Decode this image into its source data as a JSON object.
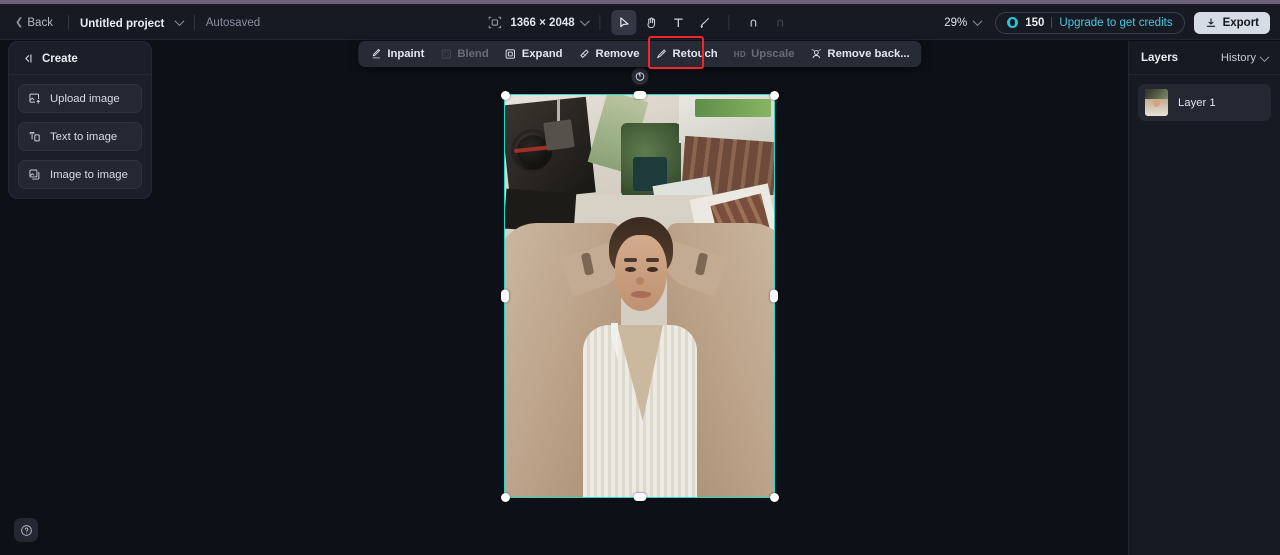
{
  "app": {
    "accent_teal": "#2fd4c8",
    "accent_cyan": "#49c8e0",
    "highlight_red": "#f4252a",
    "bg": "#0d1016",
    "panel_bg": "#171a22"
  },
  "topbar": {
    "back_label": "Back",
    "project_name": "Untitled project",
    "autosave_label": "Autosaved",
    "canvas_dimensions": "1366 × 2048",
    "tools": [
      {
        "name": "select-tool",
        "label": "Select",
        "active": true
      },
      {
        "name": "hand-tool",
        "label": "Hand",
        "active": false
      },
      {
        "name": "text-tool",
        "label": "Text",
        "active": false
      },
      {
        "name": "brush-tool",
        "label": "Brush",
        "active": false
      },
      {
        "name": "undo",
        "label": "Undo",
        "active": false
      },
      {
        "name": "redo",
        "label": "Redo",
        "active": false
      }
    ],
    "zoom_level": "29%",
    "credits_count": "150",
    "upgrade_label": "Upgrade to get credits",
    "export_label": "Export"
  },
  "action_toolbar": {
    "items": [
      {
        "label": "Inpaint",
        "icon": "inpaint-icon",
        "disabled": false,
        "highlighted": false
      },
      {
        "label": "Blend",
        "icon": "blend-icon",
        "disabled": true,
        "highlighted": false
      },
      {
        "label": "Expand",
        "icon": "expand-icon",
        "disabled": false,
        "highlighted": false
      },
      {
        "label": "Remove",
        "icon": "remove-icon",
        "disabled": false,
        "highlighted": false
      },
      {
        "label": "Retouch",
        "icon": "retouch-icon",
        "disabled": false,
        "highlighted": true
      },
      {
        "label": "Upscale",
        "prefix": "HD",
        "icon": "upscale-icon",
        "disabled": true,
        "highlighted": false
      },
      {
        "label": "Remove back...",
        "icon": "remove-background-icon",
        "disabled": false,
        "highlighted": false
      }
    ]
  },
  "create_panel": {
    "title": "Create",
    "items": [
      {
        "label": "Upload image",
        "icon": "upload-image-icon"
      },
      {
        "label": "Text to image",
        "icon": "text-to-image-icon"
      },
      {
        "label": "Image to image",
        "icon": "image-to-image-icon"
      }
    ]
  },
  "layers_panel": {
    "title": "Layers",
    "history_label": "History",
    "layers": [
      {
        "name": "Layer 1"
      }
    ]
  },
  "canvas": {
    "help_label": "?",
    "rotate_label": "Rotate"
  }
}
